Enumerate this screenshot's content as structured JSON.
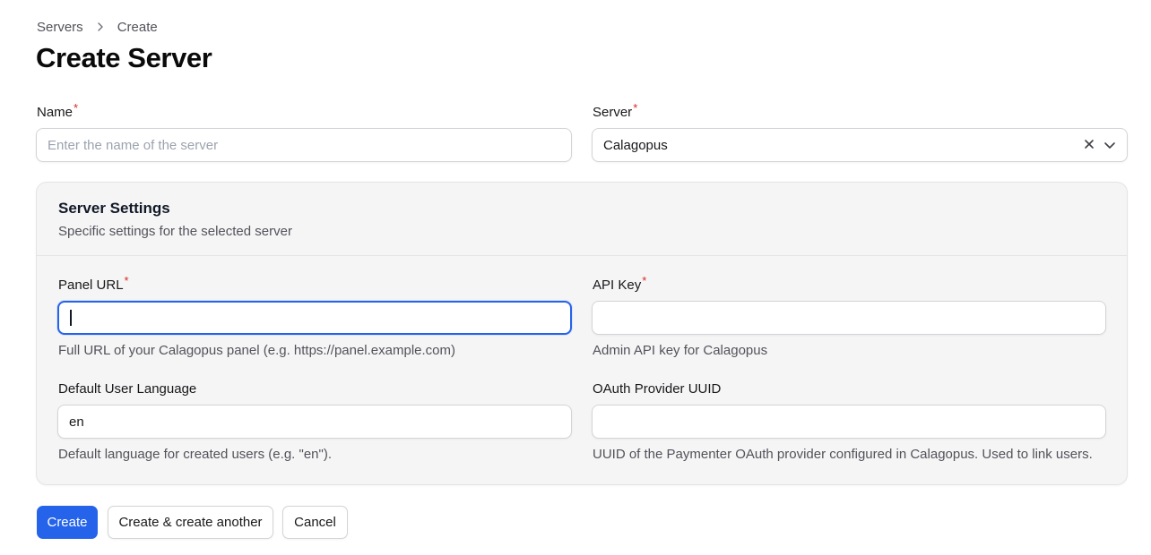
{
  "breadcrumb": {
    "items": [
      "Servers",
      "Create"
    ]
  },
  "page": {
    "title": "Create Server"
  },
  "form": {
    "name": {
      "label": "Name",
      "required_mark": "*",
      "placeholder": "Enter the name of the server",
      "value": ""
    },
    "server": {
      "label": "Server",
      "required_mark": "*",
      "value": "Calagopus",
      "icons": [
        "clear-icon",
        "chevron-down-icon"
      ]
    }
  },
  "settings": {
    "title": "Server Settings",
    "description": "Specific settings for the selected server",
    "panel_url": {
      "label": "Panel URL",
      "required_mark": "*",
      "value": "",
      "help": "Full URL of your Calagopus panel (e.g. https://panel.example.com)"
    },
    "api_key": {
      "label": "API Key",
      "required_mark": "*",
      "value": "",
      "help": "Admin API key for Calagopus"
    },
    "default_language": {
      "label": "Default User Language",
      "value": "en",
      "help": "Default language for created users (e.g. \"en\")."
    },
    "oauth_uuid": {
      "label": "OAuth Provider UUID",
      "value": "",
      "help": "UUID of the Paymenter OAuth provider configured in Calagopus. Used to link users."
    }
  },
  "actions": {
    "create": "Create",
    "create_another": "Create & create another",
    "cancel": "Cancel"
  },
  "colors": {
    "primary": "#2563eb",
    "required": "#dc2626",
    "section_bg": "#f5f5f5"
  }
}
